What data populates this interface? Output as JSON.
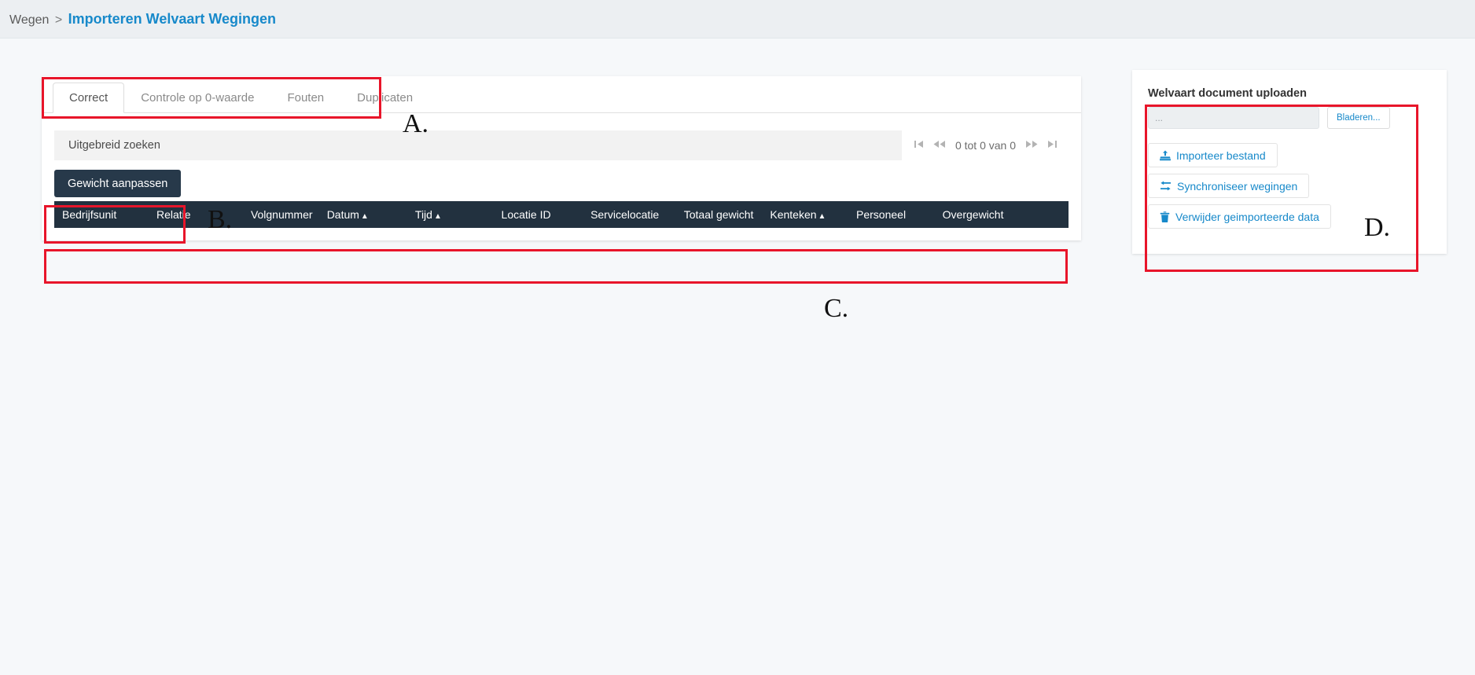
{
  "breadcrumb": {
    "root": "Wegen",
    "separator": ">",
    "current": "Importeren Welvaart Wegingen"
  },
  "tabs": [
    {
      "label": "Correct",
      "active": true
    },
    {
      "label": "Controle op 0-waarde",
      "active": false
    },
    {
      "label": "Fouten",
      "active": false
    },
    {
      "label": "Duplicaten",
      "active": false
    }
  ],
  "search": {
    "label": "Uitgebreid zoeken"
  },
  "pager": {
    "first": "⏮",
    "prev": "«",
    "info": "0 tot 0 van 0",
    "next": "»",
    "last": "⏭"
  },
  "toolbar": {
    "adjust_weight_label": "Gewicht aanpassen"
  },
  "table": {
    "columns": [
      {
        "label": "Bedrijfsunit",
        "sorted": false
      },
      {
        "label": "Relatie",
        "sorted": false
      },
      {
        "label": "Volgnummer",
        "sorted": false
      },
      {
        "label": "Datum",
        "sorted": true,
        "caret": "▲"
      },
      {
        "label": "Tijd",
        "sorted": true,
        "caret": "▲"
      },
      {
        "label": "Locatie ID",
        "sorted": true,
        "caret": "▲"
      },
      {
        "label": "Servicelocatie",
        "sorted": false
      },
      {
        "label": "Totaal gewicht",
        "sorted": false
      },
      {
        "label": "Kenteken",
        "sorted": true,
        "caret": "▲"
      },
      {
        "label": "Personeel",
        "sorted": false
      },
      {
        "label": "Overgewicht",
        "sorted": false
      }
    ],
    "rows": []
  },
  "upload_panel": {
    "title": "Welvaart document uploaden",
    "file_value": "...",
    "browse_label": "Bladeren...",
    "actions": [
      {
        "label": "Importeer bestand",
        "icon": "upload-icon"
      },
      {
        "label": "Synchroniseer wegingen",
        "icon": "exchange-icon"
      },
      {
        "label": "Verwijder geimporteerde data",
        "icon": "trash-icon"
      }
    ]
  },
  "annotations": [
    {
      "letter": "A."
    },
    {
      "letter": "B."
    },
    {
      "letter": "C."
    },
    {
      "letter": "D."
    }
  ],
  "colors": {
    "accent": "#1789ca",
    "table_header": "#22313f",
    "primary_button": "#27394a",
    "annotation": "#e8152a",
    "page_background": "#f6f8fa"
  }
}
